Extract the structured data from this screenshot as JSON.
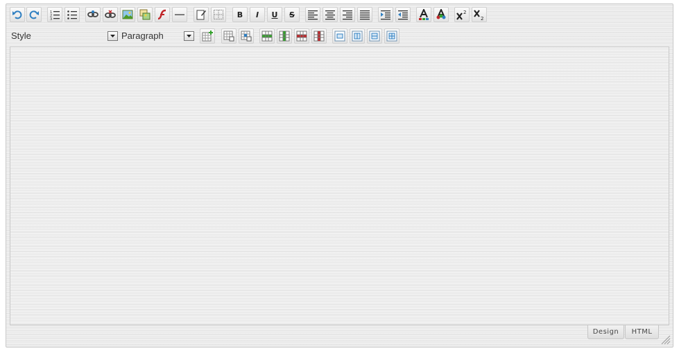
{
  "toolbar": {
    "style_select": {
      "value": "Style"
    },
    "format_select": {
      "value": "Paragraph"
    },
    "formatting": {
      "bold": "B",
      "italic": "I",
      "underline": "U",
      "strikethrough": "S"
    }
  },
  "modes": {
    "design_label": "Design",
    "html_label": "HTML"
  },
  "colors": {
    "icon_blue": "#2f7fc1",
    "icon_green": "#33a12b",
    "icon_red": "#c0262a"
  }
}
